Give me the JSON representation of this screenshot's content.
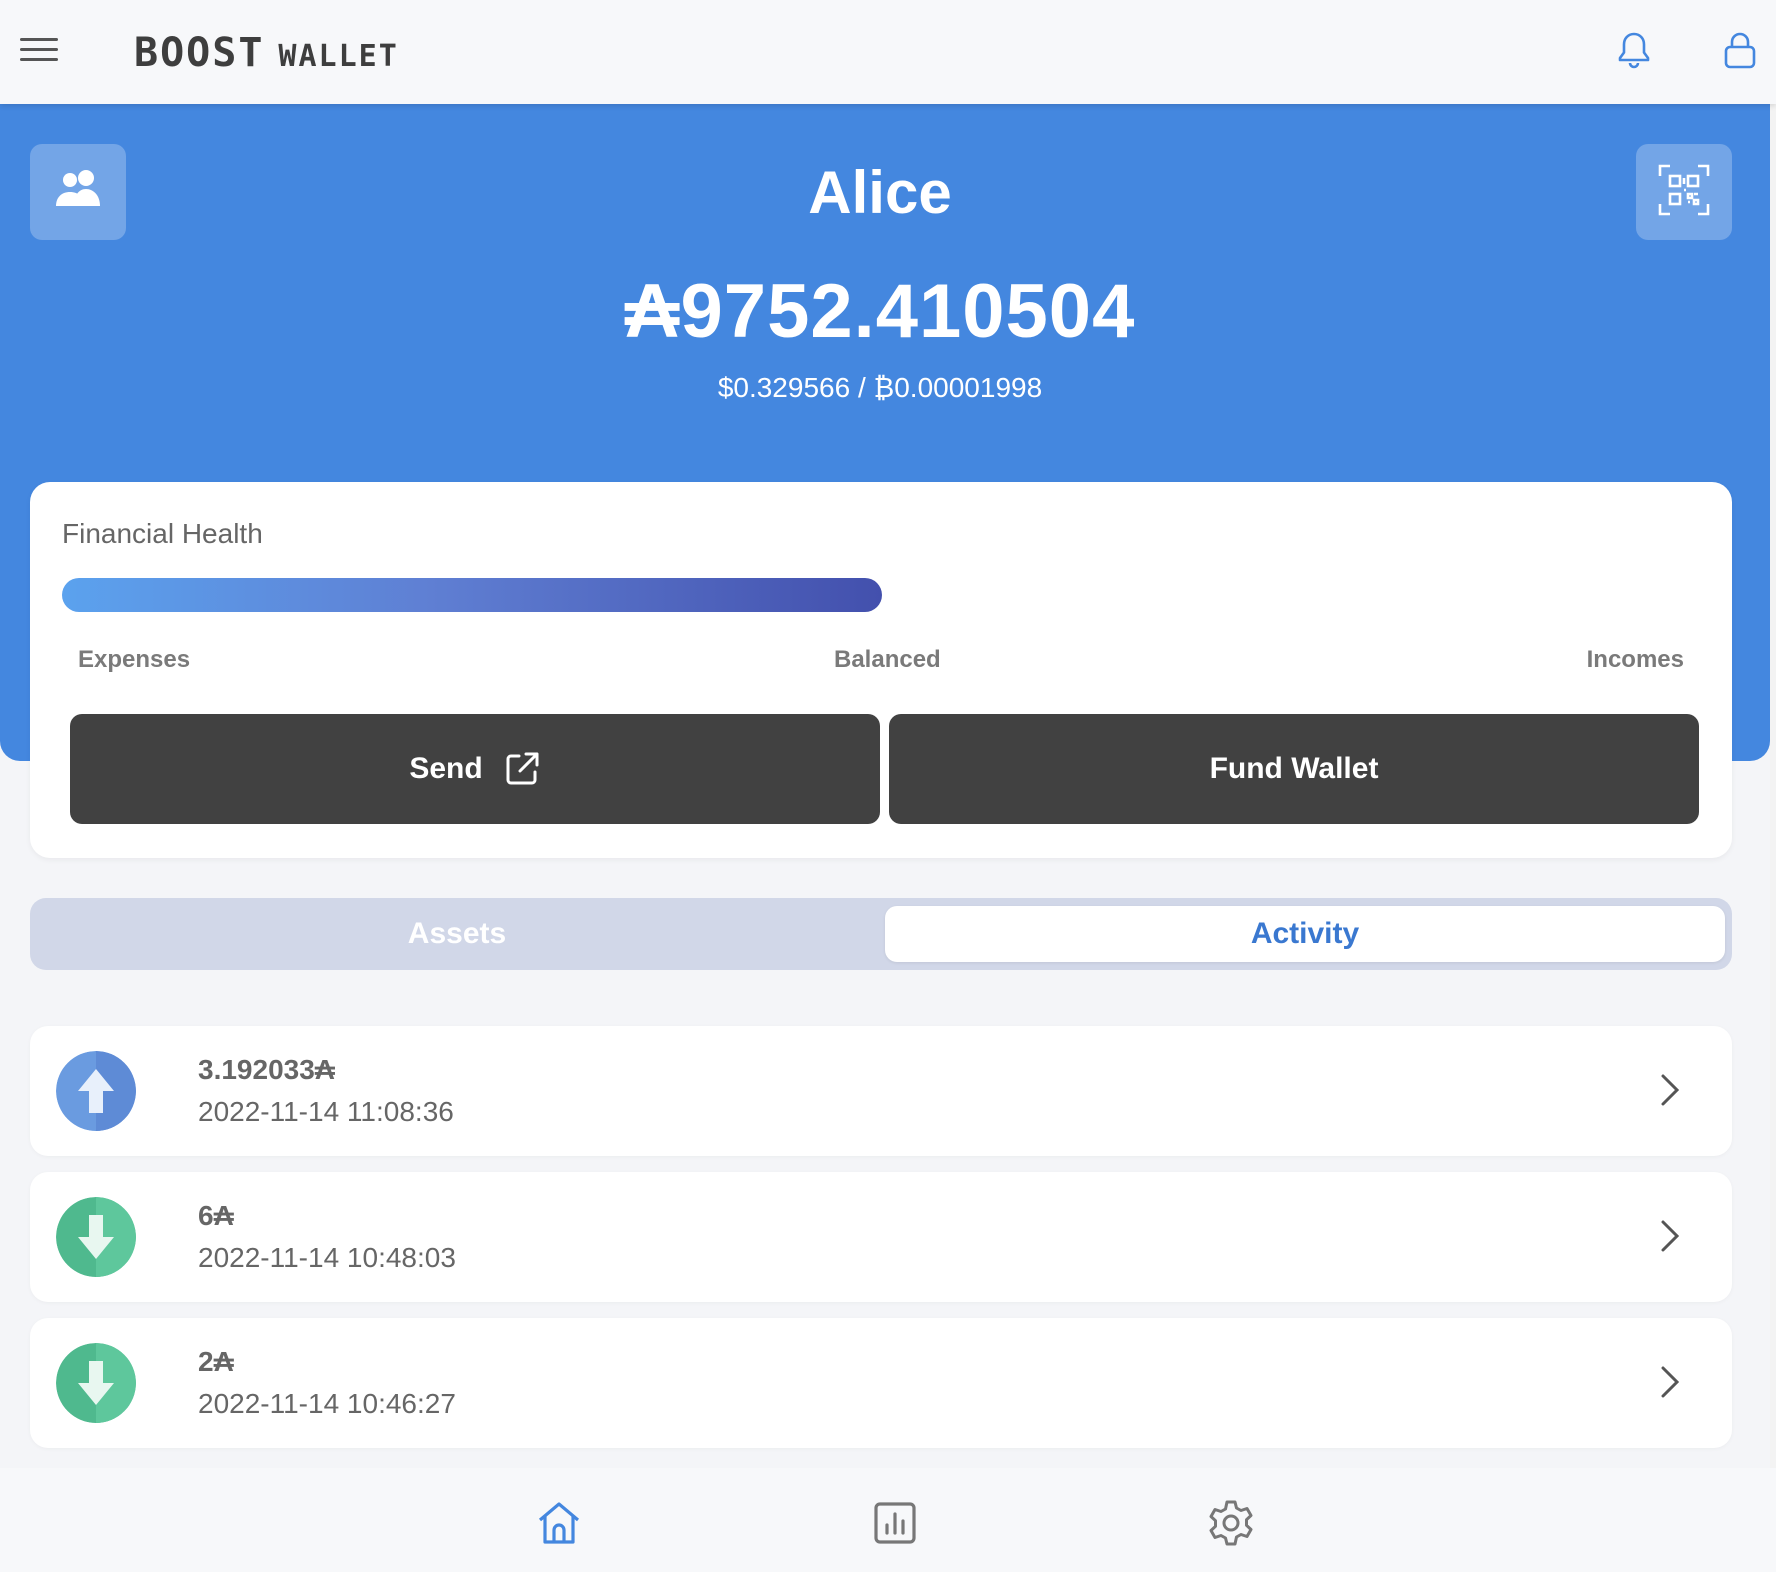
{
  "header": {
    "logo_part1": "BOOST",
    "logo_part2": "WALLET",
    "icons": [
      "menu-icon",
      "bell-icon",
      "lock-icon"
    ]
  },
  "profile": {
    "name": "Alice",
    "balance": "₳9752.410504",
    "fiat_value": "$0.329566 / ₿0.00001998",
    "icons": [
      "contacts-icon",
      "qr-code-icon"
    ]
  },
  "financial_health": {
    "title": "Financial Health",
    "progress": 0.5,
    "labels": {
      "left": "Expenses",
      "center": "Balanced",
      "right": "Incomes"
    }
  },
  "actions": {
    "send_label": "Send",
    "fund_label": "Fund Wallet"
  },
  "tabs": {
    "assets": "Assets",
    "activity": "Activity",
    "selected": "Activity"
  },
  "activity": [
    {
      "direction": "out",
      "amount": "3.192033₳",
      "timestamp": "2022-11-14 11:08:36"
    },
    {
      "direction": "in",
      "amount": "6₳",
      "timestamp": "2022-11-14 10:48:03"
    },
    {
      "direction": "in",
      "amount": "2₳",
      "timestamp": "2022-11-14 10:46:27"
    }
  ],
  "bottom_nav": [
    "home-icon",
    "chart-icon",
    "settings-icon"
  ],
  "colors": {
    "primary": "#4487df",
    "dark_button": "#414141",
    "outgoing": "#6a9be0",
    "incoming": "#4fb98e",
    "active_tab_text": "#3a78d0"
  }
}
